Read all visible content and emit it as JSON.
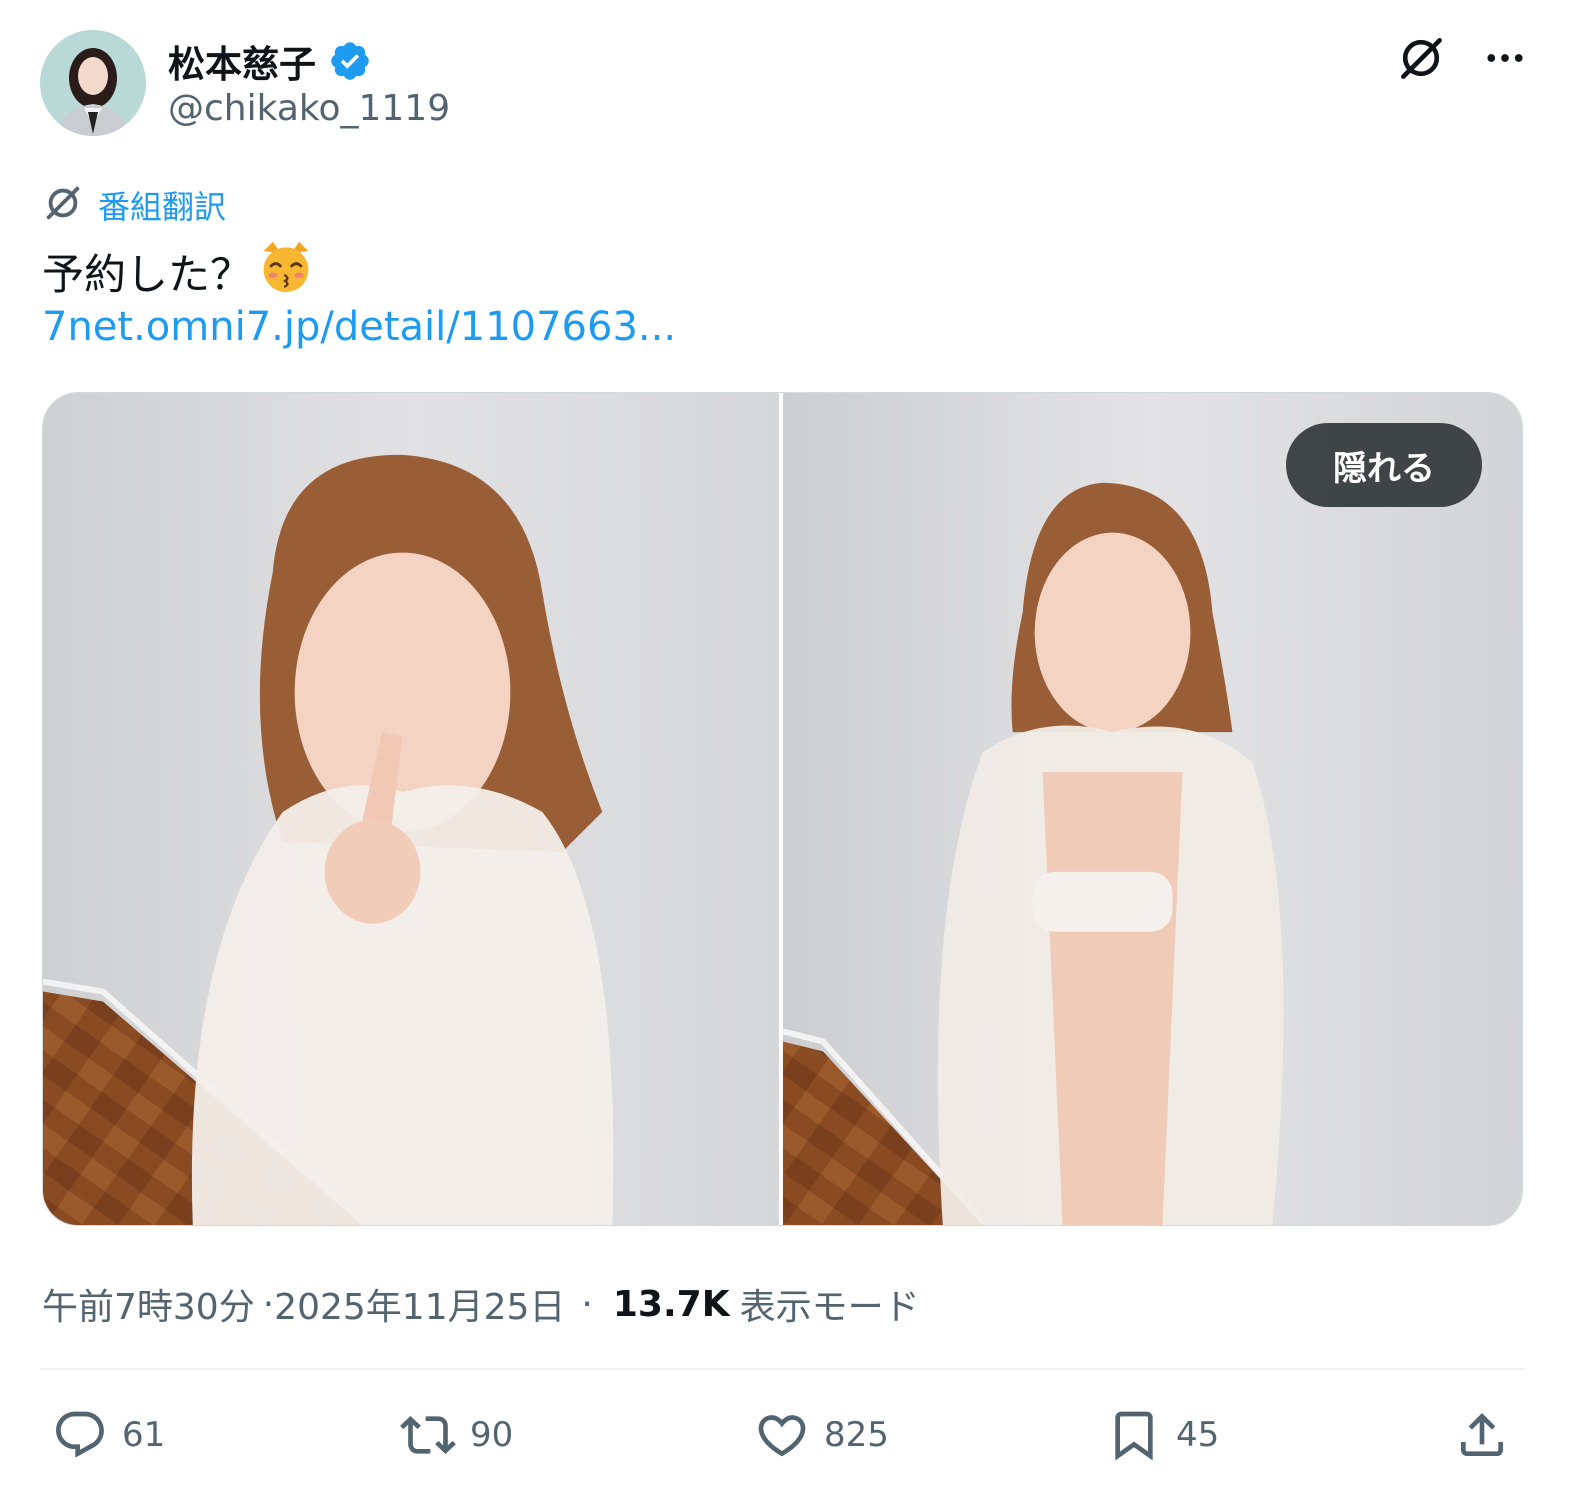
{
  "author": {
    "display_name": "松本慈子",
    "handle": "@chikako_1119",
    "verified": true
  },
  "header_icons": [
    "grok-icon",
    "more-icon"
  ],
  "translate": {
    "label": "番組翻訳"
  },
  "post": {
    "text": "予約した？",
    "emoji": "😽",
    "link": "7net.omni7.jp/detail/1107663..."
  },
  "media": {
    "hide_label": "隠れる",
    "count": 2
  },
  "meta": {
    "time": "午前7時30分",
    "separator": "·",
    "date": "2025年11月25日",
    "dot": "·",
    "views_count": "13.7K",
    "views_label": "表示モード"
  },
  "actions": {
    "replies": "61",
    "reposts": "90",
    "likes": "825",
    "bookmarks": "45"
  },
  "colors": {
    "accent": "#1d9bf0",
    "secondary_text": "#536471",
    "primary_text": "#0f1419"
  }
}
